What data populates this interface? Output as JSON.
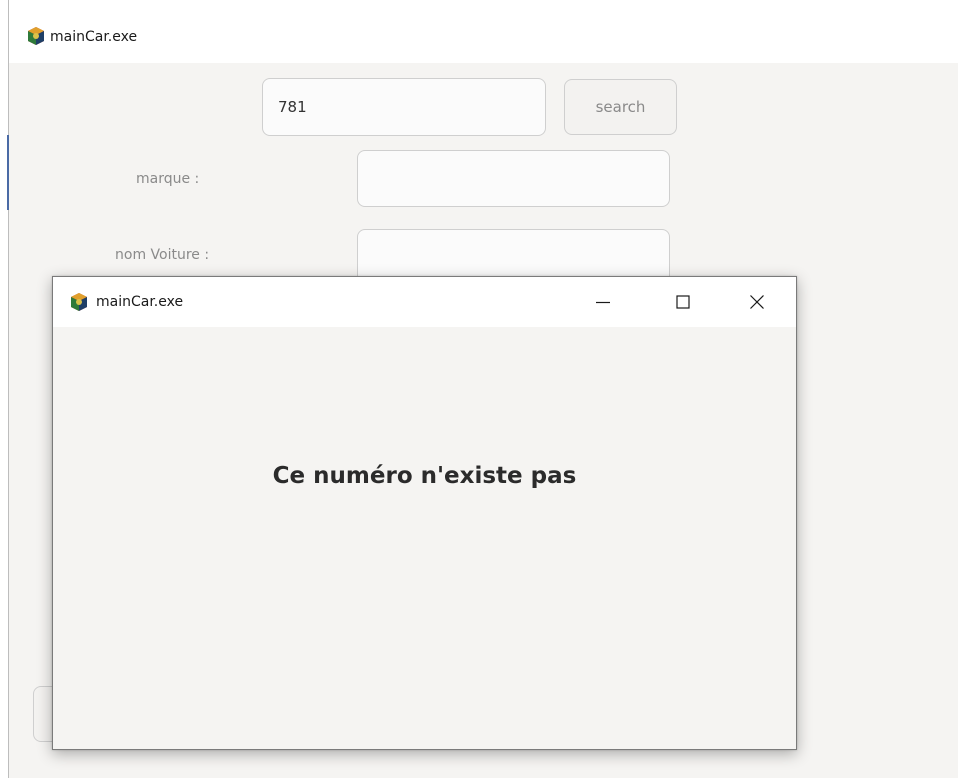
{
  "main_window": {
    "title": "mainCar.exe",
    "icon": "car-app-icon",
    "search": {
      "value": "781",
      "placeholder": ""
    },
    "search_button_label": "search",
    "fields": {
      "marque_label": "marque :",
      "nom_voiture_label": "nom Voiture :"
    }
  },
  "dialog": {
    "title": "mainCar.exe",
    "icon": "car-app-icon",
    "controls": {
      "minimize": "minimize-icon",
      "maximize": "maximize-icon",
      "close": "close-icon"
    },
    "message": "Ce numéro n'existe pas"
  },
  "colors": {
    "window_bg": "#f5f4f2",
    "titlebar_bg": "#ffffff",
    "label_text": "#8a8a8a",
    "message_text": "#2b2b2b",
    "border": "#cfcfcf"
  }
}
